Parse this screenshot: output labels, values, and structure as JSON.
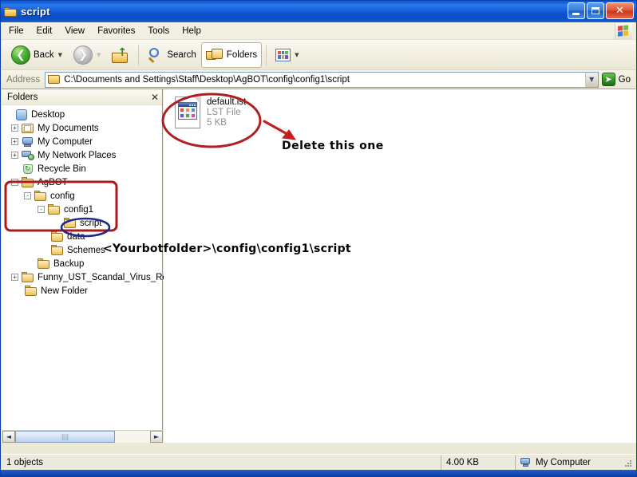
{
  "window": {
    "title": "script",
    "icon": "folder-icon",
    "buttons": {
      "minimize": "Minimize",
      "maximize": "Maximize",
      "close": "Close"
    }
  },
  "menubar": {
    "items": [
      {
        "label": "File"
      },
      {
        "label": "Edit"
      },
      {
        "label": "View"
      },
      {
        "label": "Favorites"
      },
      {
        "label": "Tools"
      },
      {
        "label": "Help"
      }
    ],
    "flag_icon": "windows-flag-icon"
  },
  "toolbar": {
    "back_label": "Back",
    "back_icon": "back-arrow-icon",
    "forward_icon": "forward-arrow-icon",
    "up_icon": "up-folder-icon",
    "search_label": "Search",
    "search_icon": "magnifier-icon",
    "folders_label": "Folders",
    "folders_icon": "folders-icon",
    "views_icon": "views-icon",
    "dropdown_glyph": "▼"
  },
  "addressbar": {
    "label": "Address",
    "value": "C:\\Documents and Settings\\Staff\\Desktop\\AgBOT\\config\\config1\\script",
    "icon": "folder-icon",
    "dropdown_glyph": "▼",
    "go_label": "Go",
    "go_icon": "go-arrow-icon"
  },
  "folders_pane": {
    "header": "Folders",
    "close_glyph": "✕",
    "tree": [
      {
        "label": "Desktop",
        "indent": 0,
        "expander": "none",
        "icon": "desktop-icon"
      },
      {
        "label": "My Documents",
        "indent": 1,
        "expander": "+",
        "icon": "my-documents-icon"
      },
      {
        "label": "My Computer",
        "indent": 1,
        "expander": "+",
        "icon": "my-computer-icon"
      },
      {
        "label": "My Network Places",
        "indent": 1,
        "expander": "+",
        "icon": "my-network-places-icon"
      },
      {
        "label": "Recycle Bin",
        "indent": 1,
        "expander": "none",
        "icon": "recycle-bin-icon"
      },
      {
        "label": "AgBOT",
        "indent": 1,
        "expander": "-",
        "icon": "folder-icon"
      },
      {
        "label": "config",
        "indent": 2,
        "expander": "-",
        "icon": "folder-icon"
      },
      {
        "label": "config1",
        "indent": 3,
        "expander": "-",
        "icon": "folder-icon"
      },
      {
        "label": "script",
        "indent": 4,
        "expander": "none",
        "icon": "folder-icon"
      },
      {
        "label": "data",
        "indent": 3,
        "expander": "none",
        "icon": "folder-icon"
      },
      {
        "label": "Schemes",
        "indent": 3,
        "expander": "none",
        "icon": "folder-icon"
      },
      {
        "label": "Backup",
        "indent": 2,
        "expander": "none",
        "icon": "folder-icon"
      },
      {
        "label": "Funny_UST_Scandal_Virus_Remo",
        "indent": 1,
        "expander": "+",
        "icon": "folder-icon"
      },
      {
        "label": "New Folder",
        "indent": 1,
        "expander": "none",
        "icon": "folder-icon"
      }
    ],
    "scrollbar": {
      "left_glyph": "◄",
      "right_glyph": "►",
      "grip": "‖‖"
    }
  },
  "file_list": {
    "items": [
      {
        "name": "default.lst",
        "type": "LST File",
        "size": "5 KB",
        "icon": "lst-file-icon"
      }
    ]
  },
  "annotations": {
    "delete_note": "Delete this one",
    "path_note": "<Yourbotfolder>\\config\\config1\\script",
    "red_ellipse_file": "red-ellipse-around-default-lst",
    "red_arrow": "red-arrow-to-delete-note",
    "red_rect_tree": "red-rectangle-around-agbot-branch",
    "blue_ellipse_script": "blue-ellipse-around-script-folder",
    "colors": {
      "red": "#b01f20",
      "blue": "#1d2a8c"
    }
  },
  "statusbar": {
    "objects": "1 objects",
    "size": "4.00 KB",
    "location": "My Computer",
    "location_icon": "my-computer-icon"
  },
  "colors": {
    "titlebar_blue": "#0c59d6",
    "chrome_beige": "#ece9d8",
    "accent_red": "#b01f20",
    "accent_blue": "#1d2a8c",
    "selection_blue": "#316ac5"
  }
}
